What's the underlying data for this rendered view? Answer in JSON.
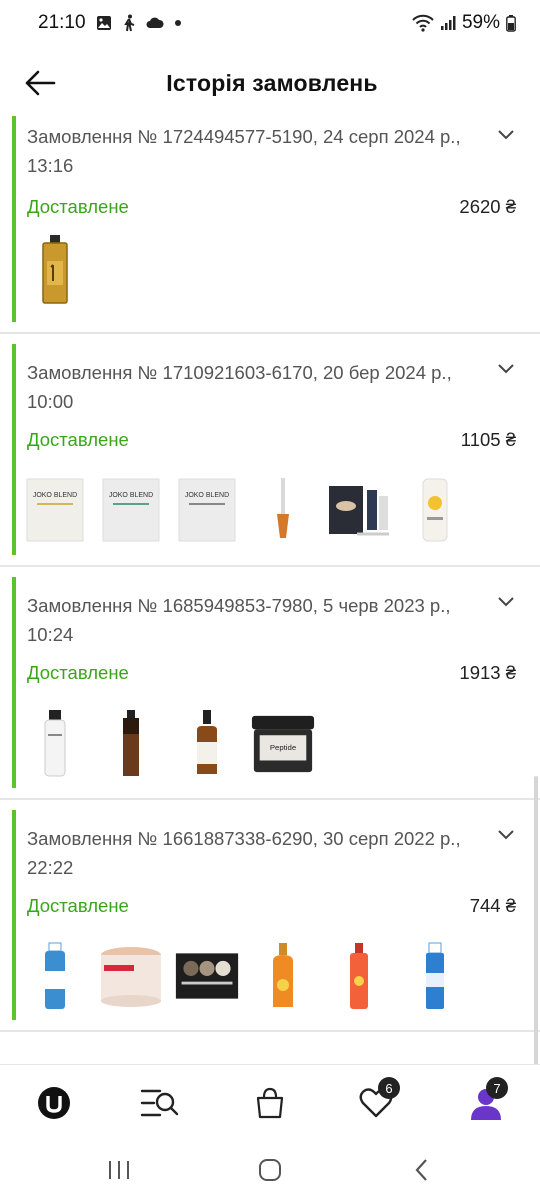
{
  "status_bar": {
    "time": "21:10",
    "battery": "59%"
  },
  "header": {
    "title": "Історія замовлень"
  },
  "orders": [
    {
      "title": "Замовлення № 1724494577-5190, 24 серп 2024 р., 13:16",
      "status": "Доставлене",
      "price": "2620 ₴"
    },
    {
      "title": "Замовлення № 1710921603-6170, 20 бер 2024 р., 10:00",
      "status": "Доставлене",
      "price": "1105 ₴"
    },
    {
      "title": "Замовлення № 1685949853-7980, 5 черв 2023 р., 10:24",
      "status": "Доставлене",
      "price": "1913 ₴"
    },
    {
      "title": "Замовлення № 1661887338-6290, 30 серп 2022 р., 22:22",
      "status": "Доставлене",
      "price": "744 ₴"
    }
  ],
  "bottom_nav": {
    "wishlist_badge": "6",
    "profile_badge": "7"
  },
  "colors": {
    "accent_green": "#5bc42a",
    "status_green": "#3aa51a",
    "profile_purple": "#6a35c9"
  }
}
